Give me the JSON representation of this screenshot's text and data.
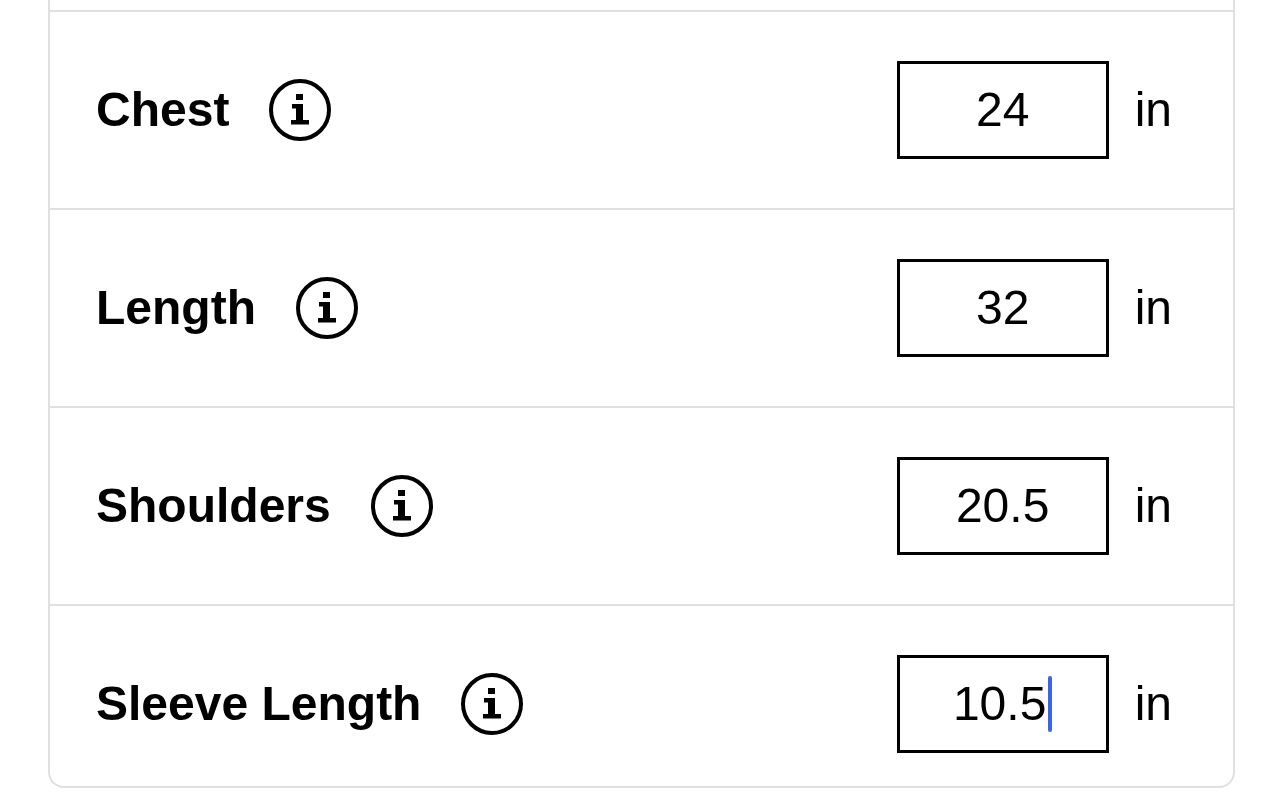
{
  "rows": [
    {
      "label": "Chest",
      "value": "24",
      "unit": "in",
      "focused": false
    },
    {
      "label": "Length",
      "value": "32",
      "unit": "in",
      "focused": false
    },
    {
      "label": "Shoulders",
      "value": "20.5",
      "unit": "in",
      "focused": false
    },
    {
      "label": "Sleeve Length",
      "value": "10.5",
      "unit": "in",
      "focused": true
    }
  ]
}
